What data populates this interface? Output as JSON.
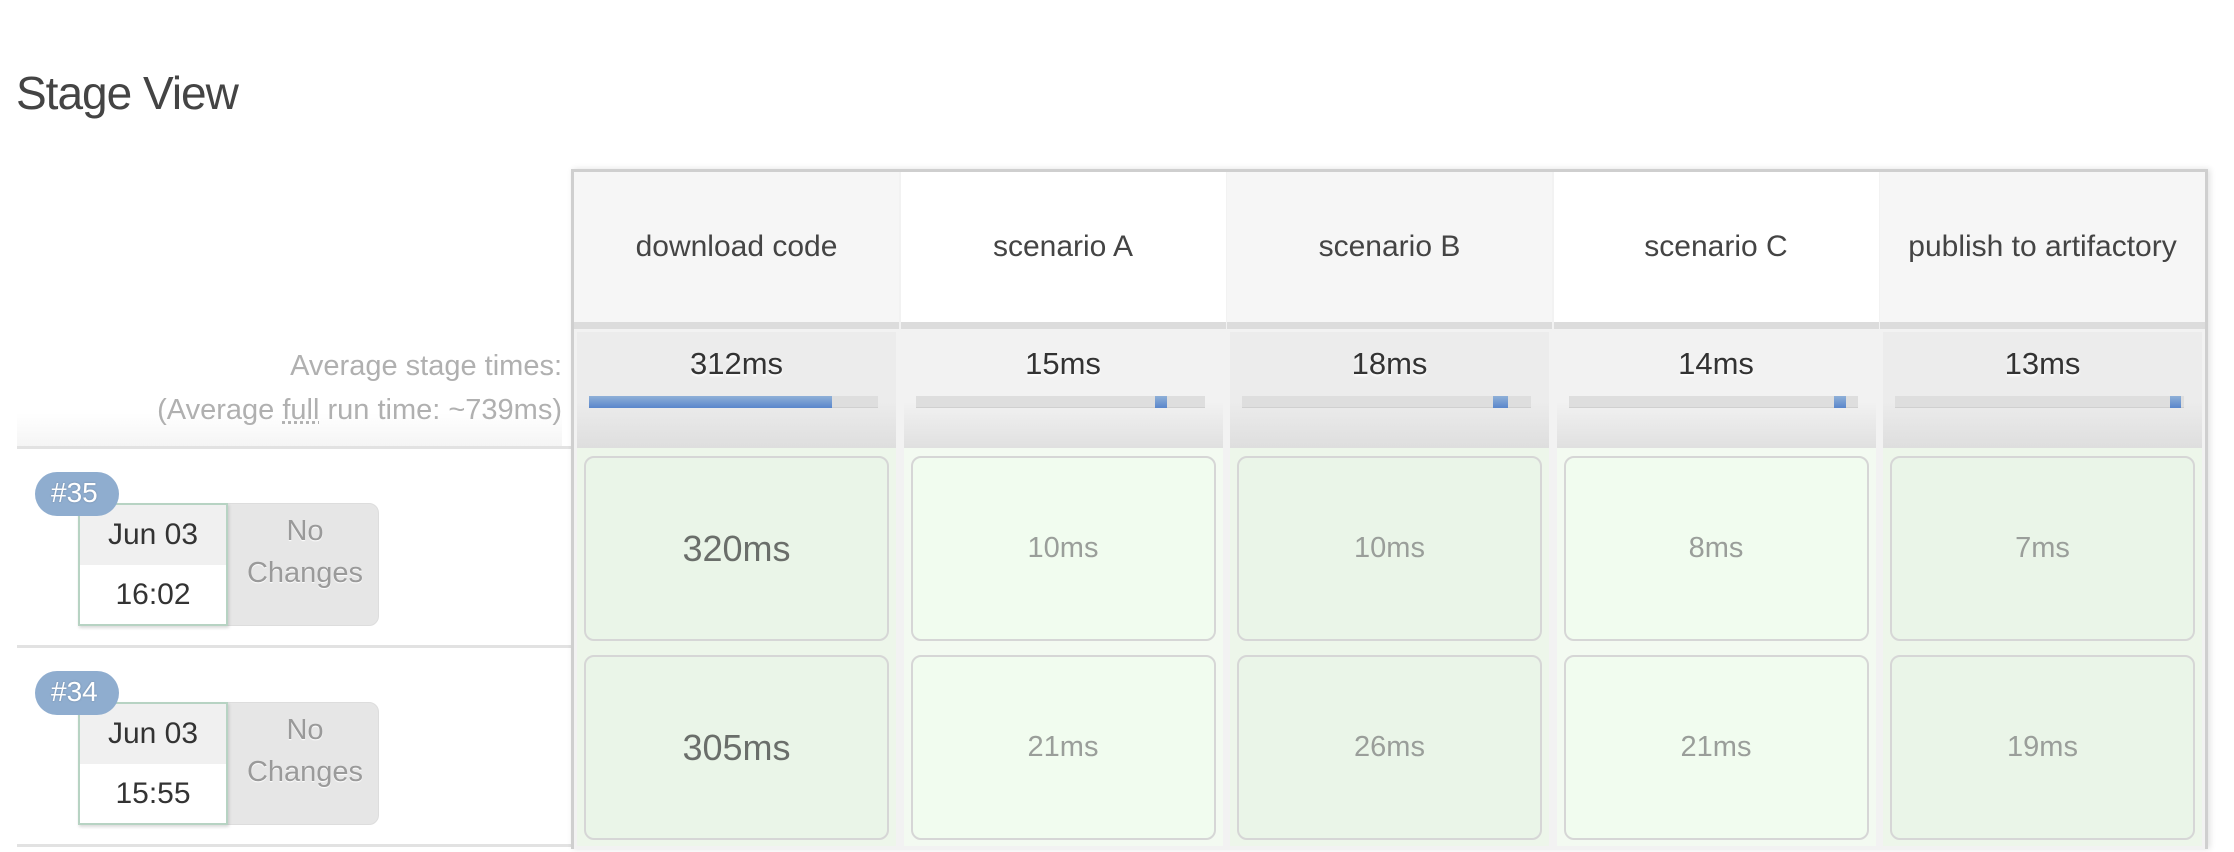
{
  "page": {
    "title": "Stage View"
  },
  "summary": {
    "avg_stage_times_label": "Average stage times:",
    "avg_full_run_prefix": "(Average ",
    "avg_full_run_emph": "full",
    "avg_full_run_suffix": " run time: ~739ms)"
  },
  "stages": [
    {
      "name": "download code",
      "avg": "312ms",
      "avg_bar_fraction": 0.84
    },
    {
      "name": "scenario A",
      "avg": "15ms",
      "avg_bar_fraction": 0.04
    },
    {
      "name": "scenario B",
      "avg": "18ms",
      "avg_bar_fraction": 0.05
    },
    {
      "name": "scenario C",
      "avg": "14ms",
      "avg_bar_fraction": 0.04
    },
    {
      "name": "publish to artifactory",
      "avg": "13ms",
      "avg_bar_fraction": 0.04
    }
  ],
  "builds": [
    {
      "number": "#35",
      "date": "Jun 03",
      "time": "16:02",
      "changes": "No Changes",
      "stage_times": [
        "320ms",
        "10ms",
        "10ms",
        "8ms",
        "7ms"
      ]
    },
    {
      "number": "#34",
      "date": "Jun 03",
      "time": "15:55",
      "changes": "No Changes",
      "stage_times": [
        "305ms",
        "21ms",
        "26ms",
        "21ms",
        "19ms"
      ]
    }
  ],
  "colors": {
    "success_cell": "#eaf5e8",
    "bar_accent": "#5a86cc",
    "badge": "#8fadcf"
  }
}
